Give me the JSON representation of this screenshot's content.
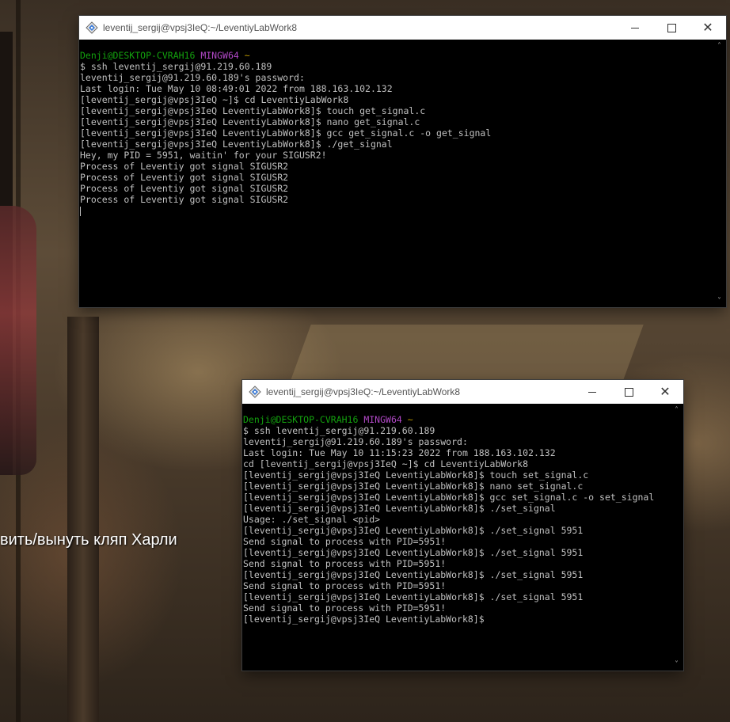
{
  "background": {
    "overlay_text": "вить/вынуть кляп Харли"
  },
  "terminal_top": {
    "title": "leventij_sergij@vpsj3IeQ:~/LeventiyLabWork8",
    "icon": "git-bash-icon",
    "lines": [
      [
        {
          "text": "Denji@DESKTOP-CVRAH16 ",
          "color": "green"
        },
        {
          "text": "MINGW64 ",
          "color": "magenta"
        },
        {
          "text": "~",
          "color": "yellow"
        }
      ],
      [
        {
          "text": "$ ssh leventij_sergij@91.219.60.189"
        }
      ],
      [
        {
          "text": "leventij_sergij@91.219.60.189's password:"
        }
      ],
      [
        {
          "text": "Last login: Tue May 10 08:49:01 2022 from 188.163.102.132"
        }
      ],
      [
        {
          "text": "[leventij_sergij@vpsj3IeQ ~]$ cd LeventiyLabWork8"
        }
      ],
      [
        {
          "text": "[leventij_sergij@vpsj3IeQ LeventiyLabWork8]$ touch get_signal.c"
        }
      ],
      [
        {
          "text": "[leventij_sergij@vpsj3IeQ LeventiyLabWork8]$ nano get_signal.c"
        }
      ],
      [
        {
          "text": "[leventij_sergij@vpsj3IeQ LeventiyLabWork8]$ gcc get_signal.c -o get_signal"
        }
      ],
      [
        {
          "text": "[leventij_sergij@vpsj3IeQ LeventiyLabWork8]$ ./get_signal"
        }
      ],
      [
        {
          "text": "Hey, my PID = 5951, waitin' for your SIGUSR2!"
        }
      ],
      [
        {
          "text": "Process of Leventiy got signal SIGUSR2"
        }
      ],
      [
        {
          "text": "Process of Leventiy got signal SIGUSR2"
        }
      ],
      [
        {
          "text": "Process of Leventiy got signal SIGUSR2"
        }
      ],
      [
        {
          "text": "Process of Leventiy got signal SIGUSR2"
        }
      ],
      [
        {
          "cursor": true
        }
      ]
    ]
  },
  "terminal_bottom": {
    "title": "leventij_sergij@vpsj3IeQ:~/LeventiyLabWork8",
    "icon": "git-bash-icon",
    "lines": [
      [
        {
          "text": "Denji@DESKTOP-CVRAH16 ",
          "color": "green"
        },
        {
          "text": "MINGW64 ",
          "color": "magenta"
        },
        {
          "text": "~",
          "color": "yellow"
        }
      ],
      [
        {
          "text": "$ ssh leventij_sergij@91.219.60.189"
        }
      ],
      [
        {
          "text": "leventij_sergij@91.219.60.189's password:"
        }
      ],
      [
        {
          "text": "Last login: Tue May 10 11:15:23 2022 from 188.163.102.132"
        }
      ],
      [
        {
          "text": "cd [leventij_sergij@vpsj3IeQ ~]$ cd LeventiyLabWork8"
        }
      ],
      [
        {
          "text": "[leventij_sergij@vpsj3IeQ LeventiyLabWork8]$ touch set_signal.c"
        }
      ],
      [
        {
          "text": "[leventij_sergij@vpsj3IeQ LeventiyLabWork8]$ nano set_signal.c"
        }
      ],
      [
        {
          "text": "[leventij_sergij@vpsj3IeQ LeventiyLabWork8]$ gcc set_signal.c -o set_signal"
        }
      ],
      [
        {
          "text": "[leventij_sergij@vpsj3IeQ LeventiyLabWork8]$ ./set_signal"
        }
      ],
      [
        {
          "text": "Usage: ./set_signal <pid>"
        }
      ],
      [
        {
          "text": "[leventij_sergij@vpsj3IeQ LeventiyLabWork8]$ ./set_signal 5951"
        }
      ],
      [
        {
          "text": "Send signal to process with PID=5951!"
        }
      ],
      [
        {
          "text": "[leventij_sergij@vpsj3IeQ LeventiyLabWork8]$ ./set_signal 5951"
        }
      ],
      [
        {
          "text": "Send signal to process with PID=5951!"
        }
      ],
      [
        {
          "text": "[leventij_sergij@vpsj3IeQ LeventiyLabWork8]$ ./set_signal 5951"
        }
      ],
      [
        {
          "text": "Send signal to process with PID=5951!"
        }
      ],
      [
        {
          "text": "[leventij_sergij@vpsj3IeQ LeventiyLabWork8]$ ./set_signal 5951"
        }
      ],
      [
        {
          "text": "Send signal to process with PID=5951!"
        }
      ],
      [
        {
          "text": "[leventij_sergij@vpsj3IeQ LeventiyLabWork8]$"
        }
      ]
    ]
  },
  "colors": {
    "green": "#13a10e",
    "magenta": "#b148c6",
    "yellow": "#c19c00",
    "text": "#c0c0c0"
  }
}
